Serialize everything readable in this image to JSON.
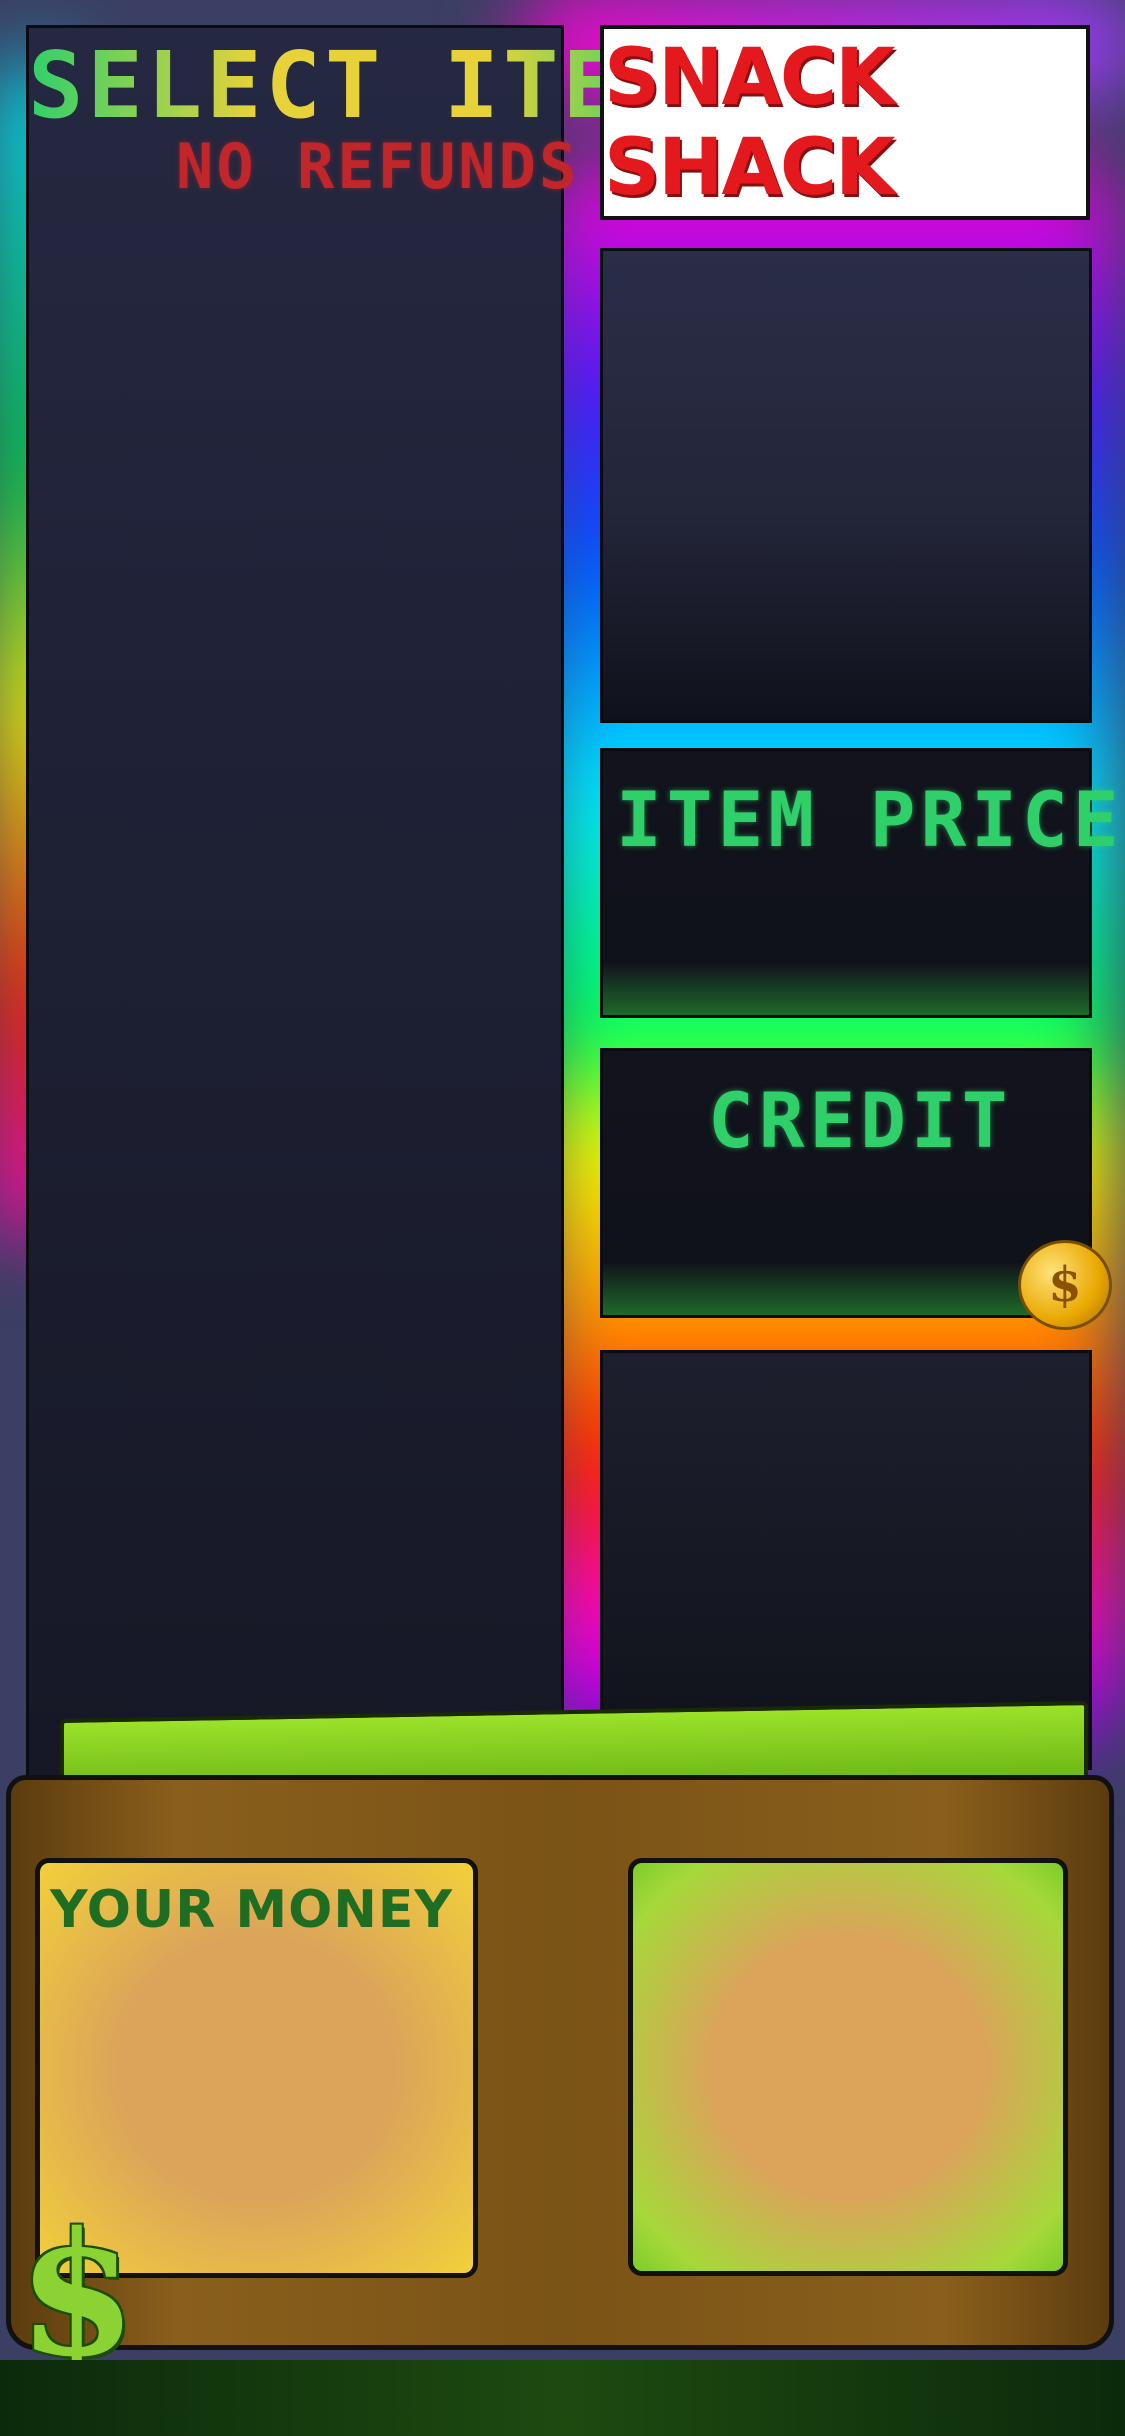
{
  "left_panel": {
    "title": "SELECT ITEM",
    "subtitle": "NO REFUNDS"
  },
  "logo": {
    "text": "SNACK SHACK"
  },
  "price_panel": {
    "label": "ITEM PRICE"
  },
  "credit_panel": {
    "label": "CREDIT"
  },
  "coin": {
    "icon": "coin-icon",
    "symbol": "$"
  },
  "wallet": {
    "label": "YOUR MONEY",
    "icon": "dollar-icon",
    "symbol": "$"
  },
  "colors": {
    "led_green": "#2fd06a",
    "led_red": "#c0262a",
    "logo_red": "#e3191e",
    "wallet_brown": "#7a5316",
    "money_green": "#8bd233"
  }
}
